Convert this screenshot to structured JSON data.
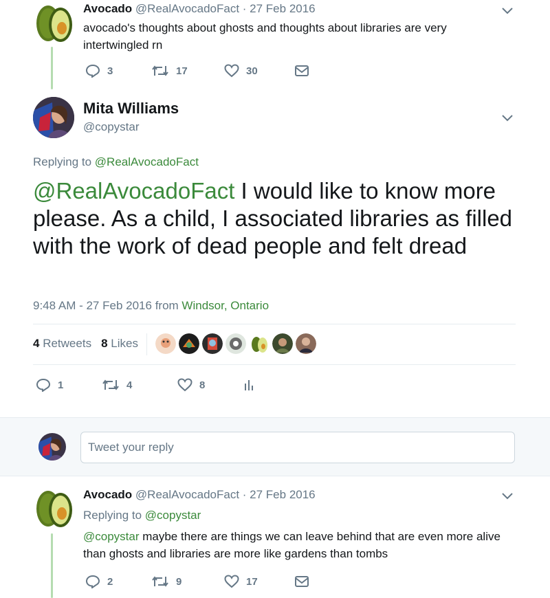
{
  "tweet1": {
    "name": "Avocado",
    "handle": "@RealAvocadoFact",
    "date": "· 27 Feb 2016",
    "text_line1": "avocado's thoughts about ghosts and thoughts about libraries are very",
    "text_line2": "intertwingled rn",
    "replies": "3",
    "retweets": "17",
    "likes": "30"
  },
  "main": {
    "name": "Mita Williams",
    "handle": "@copystar",
    "replying_prefix": "Replying to",
    "replying_to": "@RealAvocadoFact",
    "mention": "@RealAvocadoFact",
    "text_rest": " I would like to know more please. As a child, I associated libraries as filled with the work of dead people and felt dread",
    "time": "9:48 AM - 27 Feb 2016",
    "from": "from",
    "location": "Windsor, Ontario",
    "retweet_count": "4",
    "retweet_label": "Retweets",
    "like_count": "8",
    "like_label": "Likes",
    "replies": "1",
    "retweets": "4",
    "likes": "8"
  },
  "reply_box": {
    "placeholder": "Tweet your reply"
  },
  "tweet3": {
    "name": "Avocado",
    "handle": "@RealAvocadoFact",
    "date": "· 27 Feb 2016",
    "replying_prefix": "Replying to",
    "replying_to": "@copystar",
    "mention": "@copystar",
    "text_line1_rest": " maybe there are things we can leave behind that are even more alive",
    "text_line2": "than ghosts and libraries are more like gardens than tombs",
    "replies": "2",
    "retweets": "9",
    "likes": "17"
  },
  "colors": {
    "link": "#3b8a3b",
    "muted": "#657786",
    "thread_line": "#b5dcb0"
  },
  "icons": [
    "avocado-avatar-icon",
    "user-avatar-icon",
    "chevron-down-icon",
    "reply-icon",
    "retweet-icon",
    "like-icon",
    "dm-envelope-icon",
    "analytics-icon"
  ]
}
